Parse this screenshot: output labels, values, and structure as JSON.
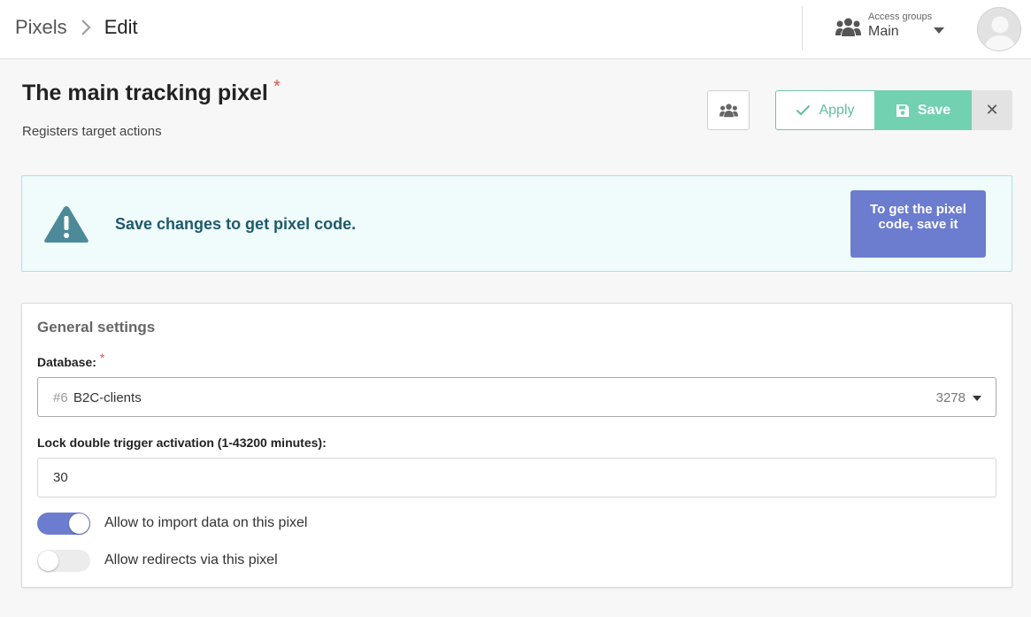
{
  "breadcrumb": {
    "root": "Pixels",
    "current": "Edit"
  },
  "access_groups": {
    "caption": "Access groups",
    "value": "Main",
    "icon": "users-icon"
  },
  "avatar": {
    "icon": "user-avatar-icon"
  },
  "page": {
    "title": "The main tracking pixel",
    "required_mark": "*",
    "subtitle": "Registers target actions"
  },
  "toolbar": {
    "access_icon": "users-icon",
    "apply_label": "Apply",
    "save_label": "Save",
    "close_label": "✕"
  },
  "alert": {
    "icon": "warning-triangle-icon",
    "message": "Save changes to get pixel code.",
    "button_label": "To get the pixel code, save it"
  },
  "general": {
    "title": "General settings",
    "database": {
      "label": "Database:",
      "required_mark": "*",
      "selected_id": "#6",
      "selected_name": "B2C-clients",
      "selected_count": "3278"
    },
    "lock": {
      "label": "Lock double trigger activation (1-43200 minutes):",
      "value": "30"
    },
    "toggles": [
      {
        "label": "Allow to import data on this pixel",
        "on": true
      },
      {
        "label": "Allow redirects via this pixel",
        "on": false
      }
    ]
  },
  "colors": {
    "accent": "#6c7ccf",
    "apply_green": "#5fbf9c",
    "save_green": "#72d1b0",
    "alert_bg": "#f0fbfc",
    "alert_text": "#1d5a6b",
    "required_red": "#d9534f"
  }
}
